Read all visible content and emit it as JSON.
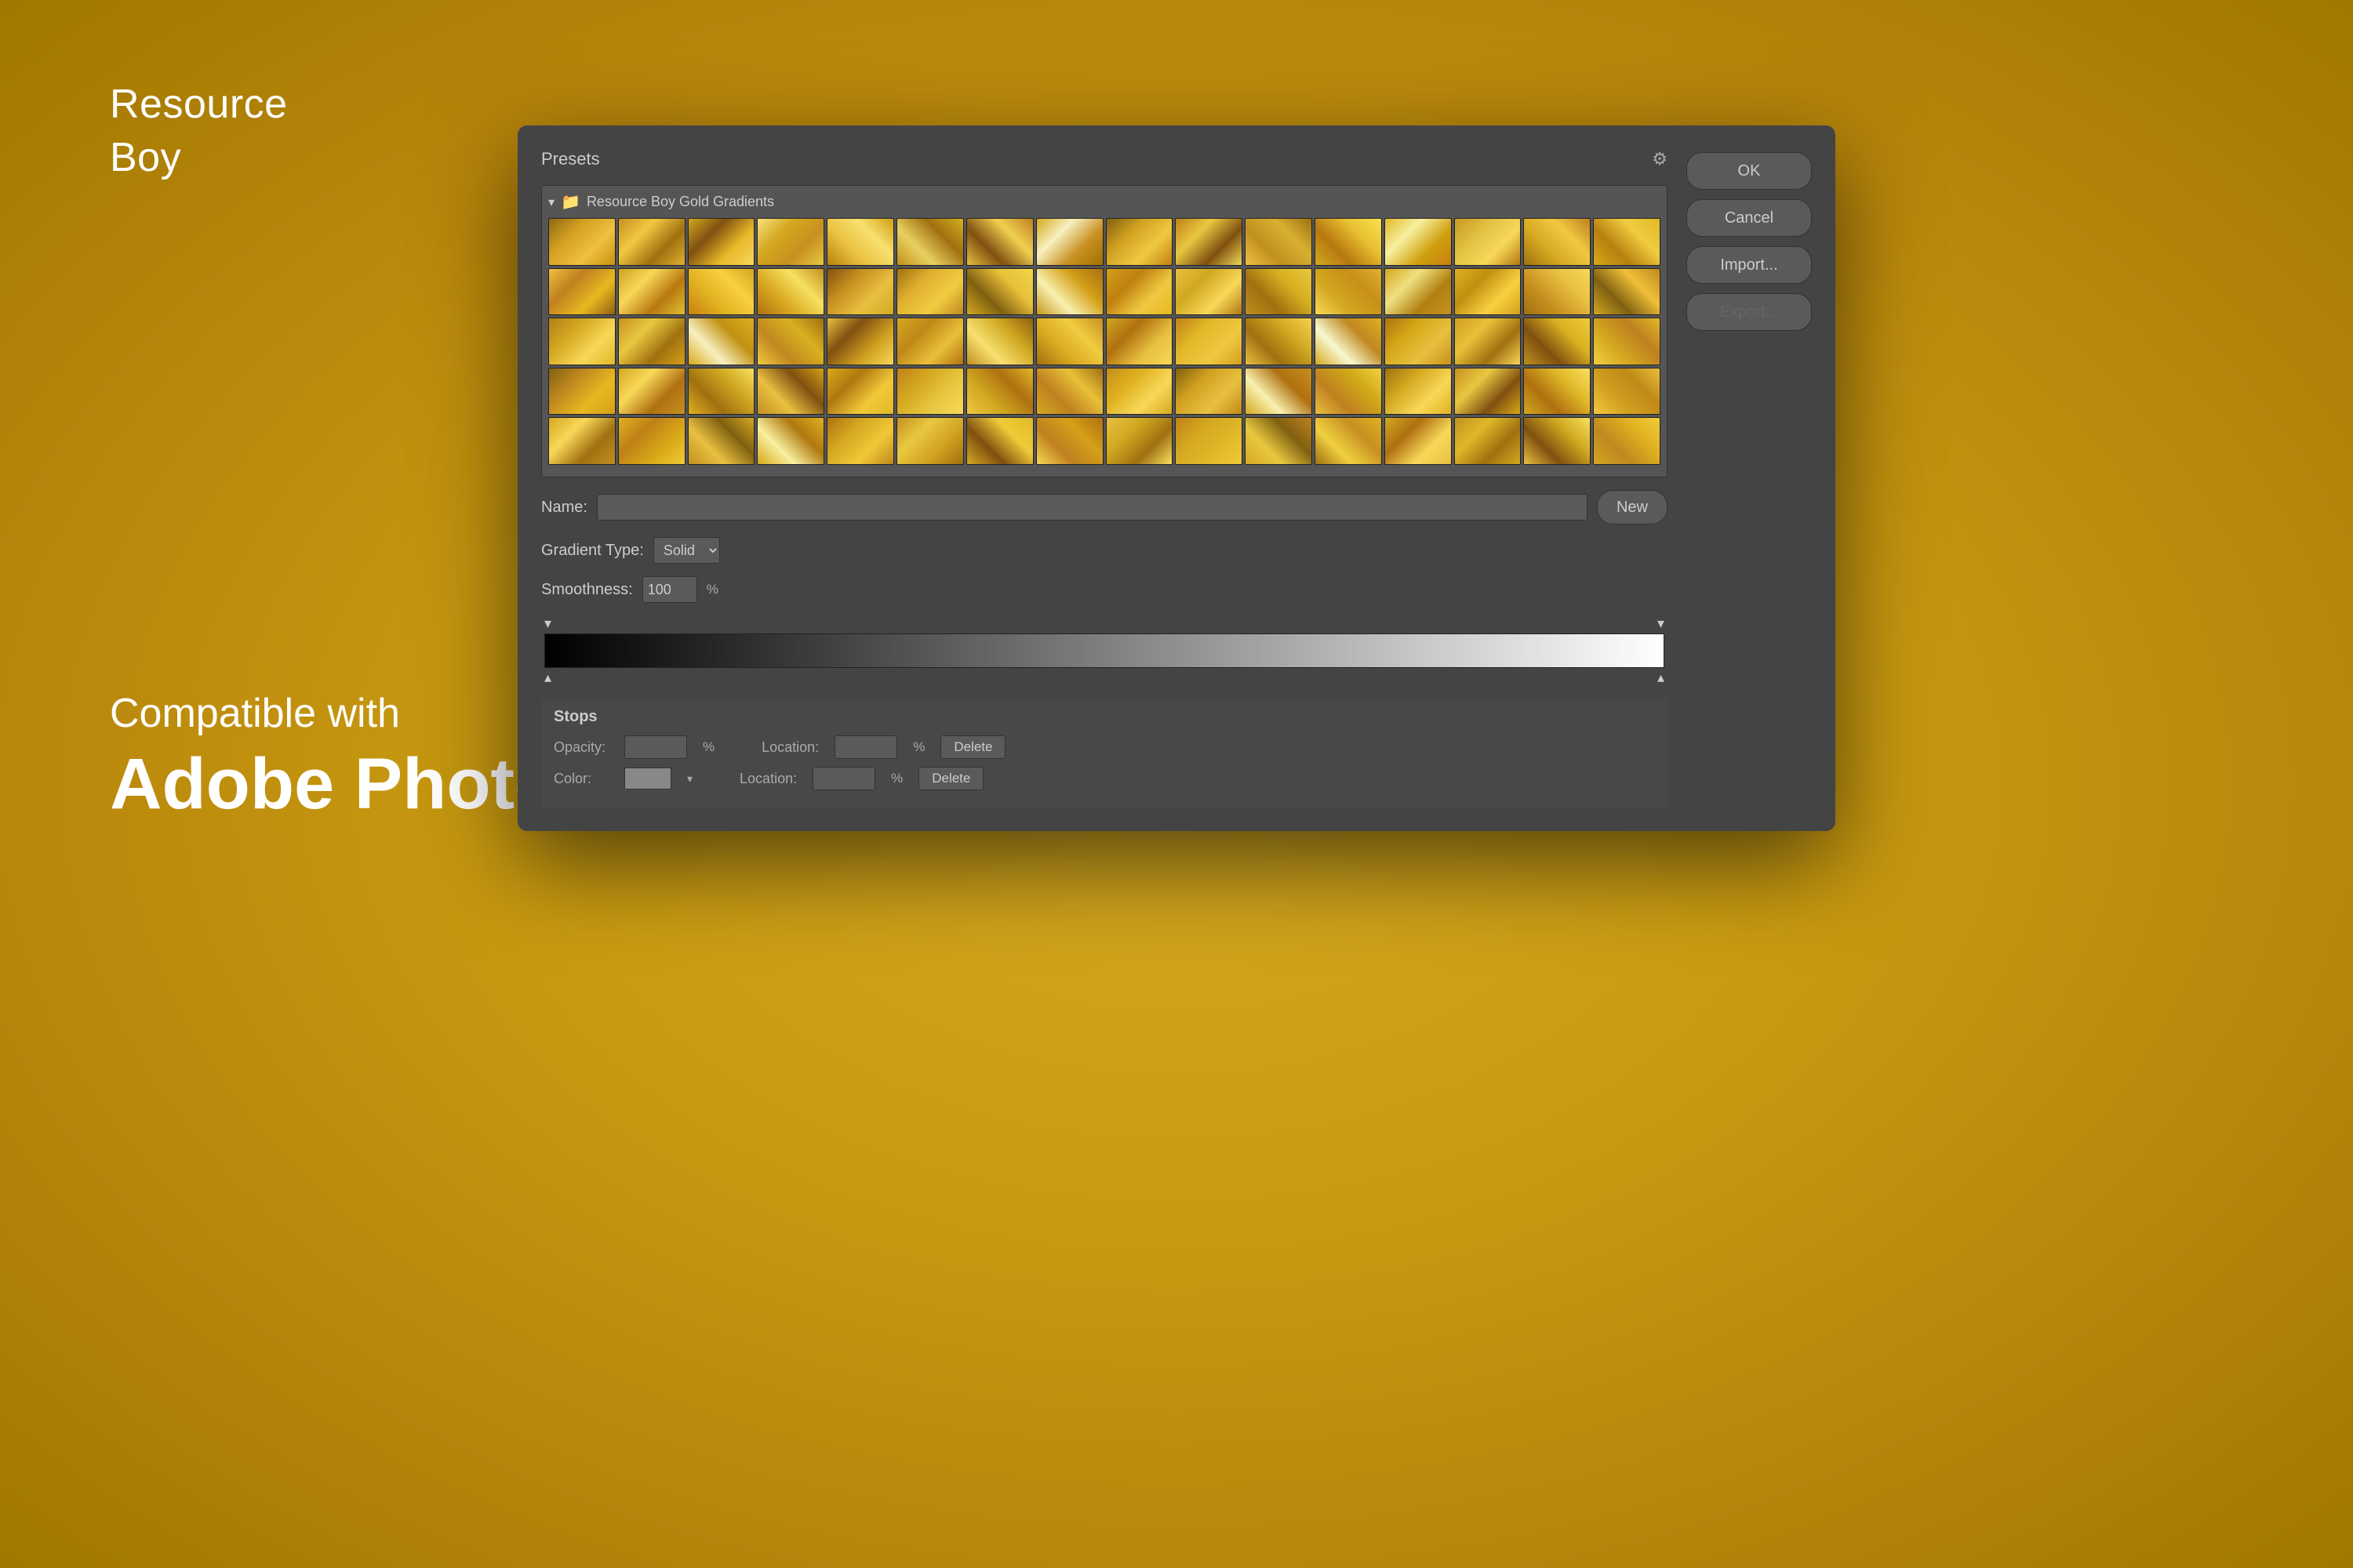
{
  "brand": {
    "name_line1": "Resource",
    "name_line2": "Boy",
    "compatible_label": "Compatible with",
    "app_name": "Adobe Photoshop"
  },
  "dialog": {
    "presets_title": "Presets",
    "folder_name": "Resource Boy Gold Gradients",
    "name_label": "Name:",
    "name_value": "",
    "gradient_type_label": "Gradient Type:",
    "gradient_type_value": "Solid",
    "smoothness_label": "Smoothness:",
    "smoothness_value": "100",
    "percent_symbol": "%",
    "stops_title": "Stops",
    "opacity_label": "Opacity:",
    "location_label": "Location:",
    "color_label": "Color:",
    "delete_label": "Delete",
    "buttons": {
      "ok": "OK",
      "cancel": "Cancel",
      "import": "Import...",
      "export": "Export...",
      "new": "New"
    }
  }
}
